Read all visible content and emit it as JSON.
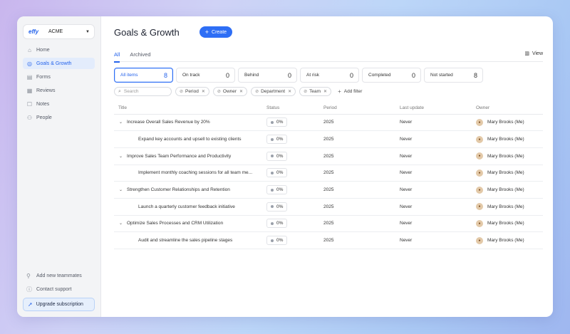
{
  "sidebar": {
    "workspace": {
      "logo": "effy",
      "name": "ACME"
    },
    "items": [
      {
        "label": "Home",
        "icon": "home-icon",
        "active": false
      },
      {
        "label": "Goals & Growth",
        "icon": "target-icon",
        "active": true
      },
      {
        "label": "Forms",
        "icon": "form-icon",
        "active": false
      },
      {
        "label": "Reviews",
        "icon": "review-icon",
        "active": false
      },
      {
        "label": "Notes",
        "icon": "note-icon",
        "active": false
      },
      {
        "label": "People",
        "icon": "people-icon",
        "active": false
      }
    ],
    "bottom": {
      "add_teammates": "Add new teammates",
      "contact_support": "Contact support",
      "upgrade": "Upgrade subscription"
    }
  },
  "header": {
    "title": "Goals & Growth",
    "create_label": "Create"
  },
  "tabs": [
    {
      "label": "All",
      "active": true
    },
    {
      "label": "Archived",
      "active": false
    }
  ],
  "view_label": "View",
  "status_cards": [
    {
      "label": "All items",
      "count": "8",
      "active": true
    },
    {
      "label": "On track",
      "count": "0",
      "active": false
    },
    {
      "label": "Behind",
      "count": "0",
      "active": false
    },
    {
      "label": "At risk",
      "count": "0",
      "active": false
    },
    {
      "label": "Completed",
      "count": "0",
      "active": false
    },
    {
      "label": "Not started",
      "count": "8",
      "active": false
    }
  ],
  "filters": {
    "search_placeholder": "Search",
    "chips": [
      "Period",
      "Owner",
      "Department",
      "Team"
    ],
    "add_filter": "Add filter"
  },
  "table": {
    "columns": [
      "Title",
      "Status",
      "Period",
      "Last update",
      "Owner"
    ],
    "rows": [
      {
        "title": "Increase Overall Sales Revenue by 20%",
        "level": 0,
        "status": "0%",
        "period": "2025",
        "last_update": "Never",
        "owner": "Mary Brooks (Me)"
      },
      {
        "title": "Expand key accounts and upsell to existing clients",
        "level": 1,
        "status": "0%",
        "period": "2025",
        "last_update": "Never",
        "owner": "Mary Brooks (Me)"
      },
      {
        "title": "Improve Sales Team Performance and Productivity",
        "level": 0,
        "status": "0%",
        "period": "2025",
        "last_update": "Never",
        "owner": "Mary Brooks (Me)"
      },
      {
        "title": "Implement monthly coaching sessions for all team me...",
        "level": 1,
        "status": "0%",
        "period": "2025",
        "last_update": "Never",
        "owner": "Mary Brooks (Me)"
      },
      {
        "title": "Strengthen Customer Relationships and Retention",
        "level": 0,
        "status": "0%",
        "period": "2025",
        "last_update": "Never",
        "owner": "Mary Brooks (Me)"
      },
      {
        "title": "Launch a quarterly customer feedback initiative",
        "level": 1,
        "status": "0%",
        "period": "2025",
        "last_update": "Never",
        "owner": "Mary Brooks (Me)"
      },
      {
        "title": "Optimize Sales Processes and CRM Utilization",
        "level": 0,
        "status": "0%",
        "period": "2025",
        "last_update": "Never",
        "owner": "Mary Brooks (Me)"
      },
      {
        "title": "Audit and streamline the sales pipeline stages",
        "level": 1,
        "status": "0%",
        "period": "2025",
        "last_update": "Never",
        "owner": "Mary Brooks (Me)"
      }
    ]
  },
  "colors": {
    "accent": "#2e6ef5",
    "sidebar_bg": "#f3f4f6"
  }
}
